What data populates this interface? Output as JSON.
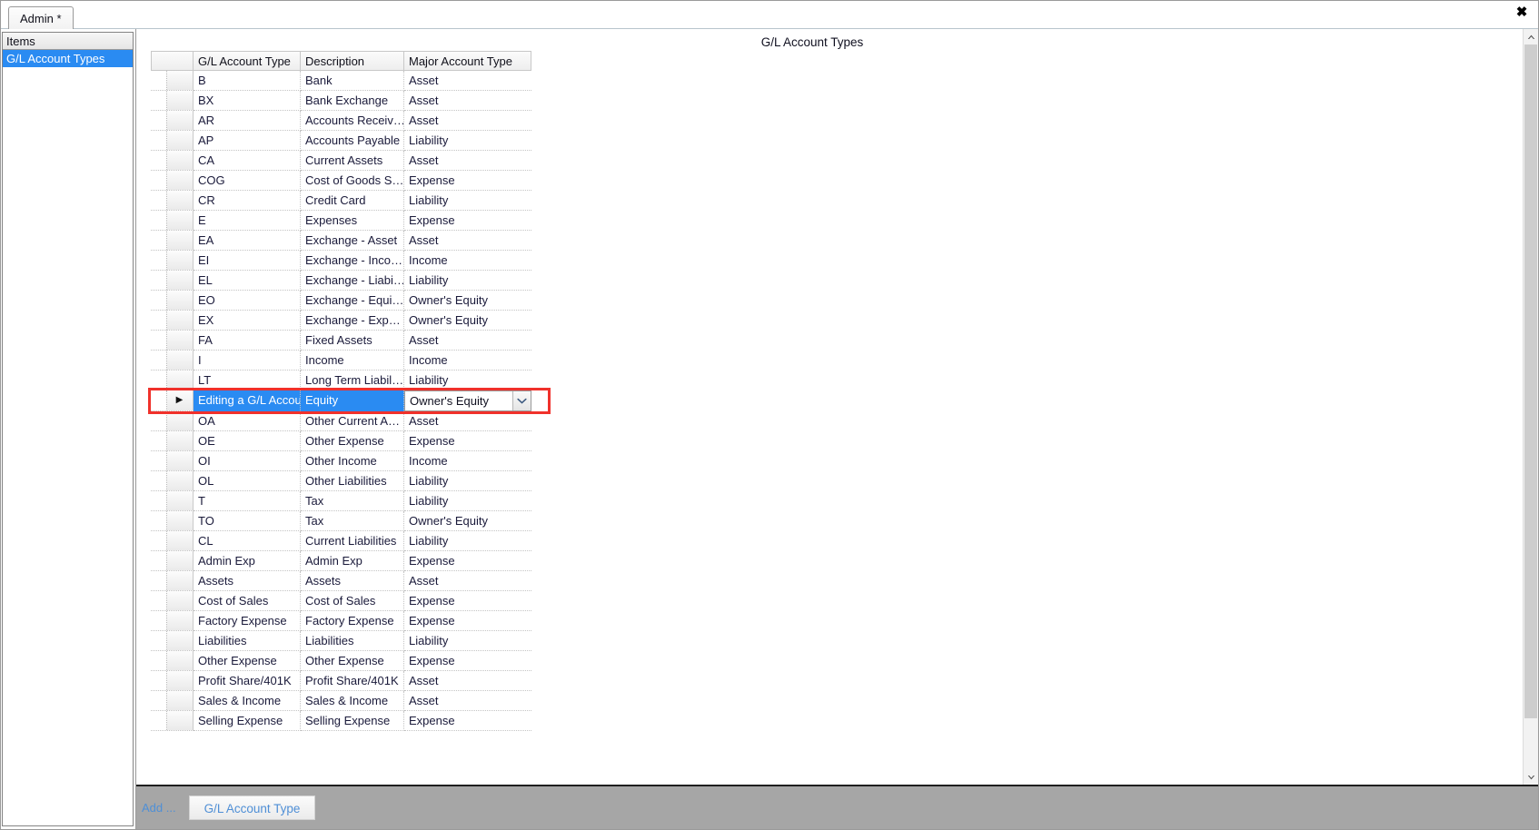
{
  "window": {
    "tab_label": "Admin *",
    "close_label": "✖"
  },
  "sidebar": {
    "header": "Items",
    "items": [
      {
        "label": "G/L Account Types",
        "selected": true
      }
    ]
  },
  "main": {
    "page_title": "G/L Account Types"
  },
  "grid": {
    "columns": [
      "G/L Account Type",
      "Description",
      "Major Account Type"
    ],
    "rows": [
      {
        "type": "B",
        "desc": "Bank",
        "major": "Asset"
      },
      {
        "type": "BX",
        "desc": "Bank Exchange",
        "major": "Asset"
      },
      {
        "type": "AR",
        "desc": "Accounts Receiv…",
        "major": "Asset"
      },
      {
        "type": "AP",
        "desc": "Accounts Payable",
        "major": "Liability"
      },
      {
        "type": "CA",
        "desc": "Current Assets",
        "major": "Asset"
      },
      {
        "type": "COG",
        "desc": "Cost of Goods S…",
        "major": "Expense"
      },
      {
        "type": "CR",
        "desc": "Credit Card",
        "major": "Liability"
      },
      {
        "type": "E",
        "desc": "Expenses",
        "major": "Expense"
      },
      {
        "type": "EA",
        "desc": "Exchange - Asset",
        "major": "Asset"
      },
      {
        "type": "EI",
        "desc": "Exchange - Inco…",
        "major": "Income"
      },
      {
        "type": "EL",
        "desc": "Exchange - Liabi…",
        "major": "Liability"
      },
      {
        "type": "EO",
        "desc": "Exchange - Equi…",
        "major": "Owner's Equity"
      },
      {
        "type": "EX",
        "desc": "Exchange - Exp…",
        "major": "Owner's Equity"
      },
      {
        "type": "FA",
        "desc": "Fixed Assets",
        "major": "Asset"
      },
      {
        "type": "I",
        "desc": "Income",
        "major": "Income"
      },
      {
        "type": "LT",
        "desc": "Long Term Liabil…",
        "major": "Liability"
      },
      {
        "type": "Editing a G/L Accou…",
        "desc": "Equity",
        "major": "Owner's Equity",
        "editing": true
      },
      {
        "type": "OA",
        "desc": "Other Current A…",
        "major": "Asset"
      },
      {
        "type": "OE",
        "desc": "Other Expense",
        "major": "Expense"
      },
      {
        "type": "OI",
        "desc": "Other Income",
        "major": "Income"
      },
      {
        "type": "OL",
        "desc": "Other Liabilities",
        "major": "Liability"
      },
      {
        "type": "T",
        "desc": "Tax",
        "major": "Liability"
      },
      {
        "type": "TO",
        "desc": "Tax",
        "major": "Owner's Equity"
      },
      {
        "type": "CL",
        "desc": "Current Liabilities",
        "major": "Liability"
      },
      {
        "type": "Admin Exp",
        "desc": "Admin Exp",
        "major": "Expense"
      },
      {
        "type": "Assets",
        "desc": "Assets",
        "major": "Asset"
      },
      {
        "type": "Cost of Sales",
        "desc": "Cost of Sales",
        "major": "Expense"
      },
      {
        "type": "Factory Expense",
        "desc": "Factory Expense",
        "major": "Expense"
      },
      {
        "type": "Liabilities",
        "desc": "Liabilities",
        "major": "Liability"
      },
      {
        "type": "Other Expense",
        "desc": "Other Expense",
        "major": "Expense"
      },
      {
        "type": "Profit Share/401K",
        "desc": "Profit Share/401K",
        "major": "Asset"
      },
      {
        "type": "Sales & Income",
        "desc": "Sales & Income",
        "major": "Asset"
      },
      {
        "type": "Selling Expense",
        "desc": "Selling Expense",
        "major": "Expense"
      }
    ]
  },
  "editor": {
    "value": "Owner's Equity",
    "dropdown_icon": "chevron-down-icon"
  },
  "scrollbar": {
    "up_icon": "chevron-up-icon",
    "down_icon": "chevron-down-icon"
  },
  "bottom_bar": {
    "add_label": "Add ...",
    "active_tab": "G/L Account Type"
  },
  "colors": {
    "selection_blue": "#2a8bf2",
    "highlight_red": "#f0312b",
    "link_blue": "#4f8fd6",
    "bottom_bar_gray": "#a6a6a6"
  }
}
